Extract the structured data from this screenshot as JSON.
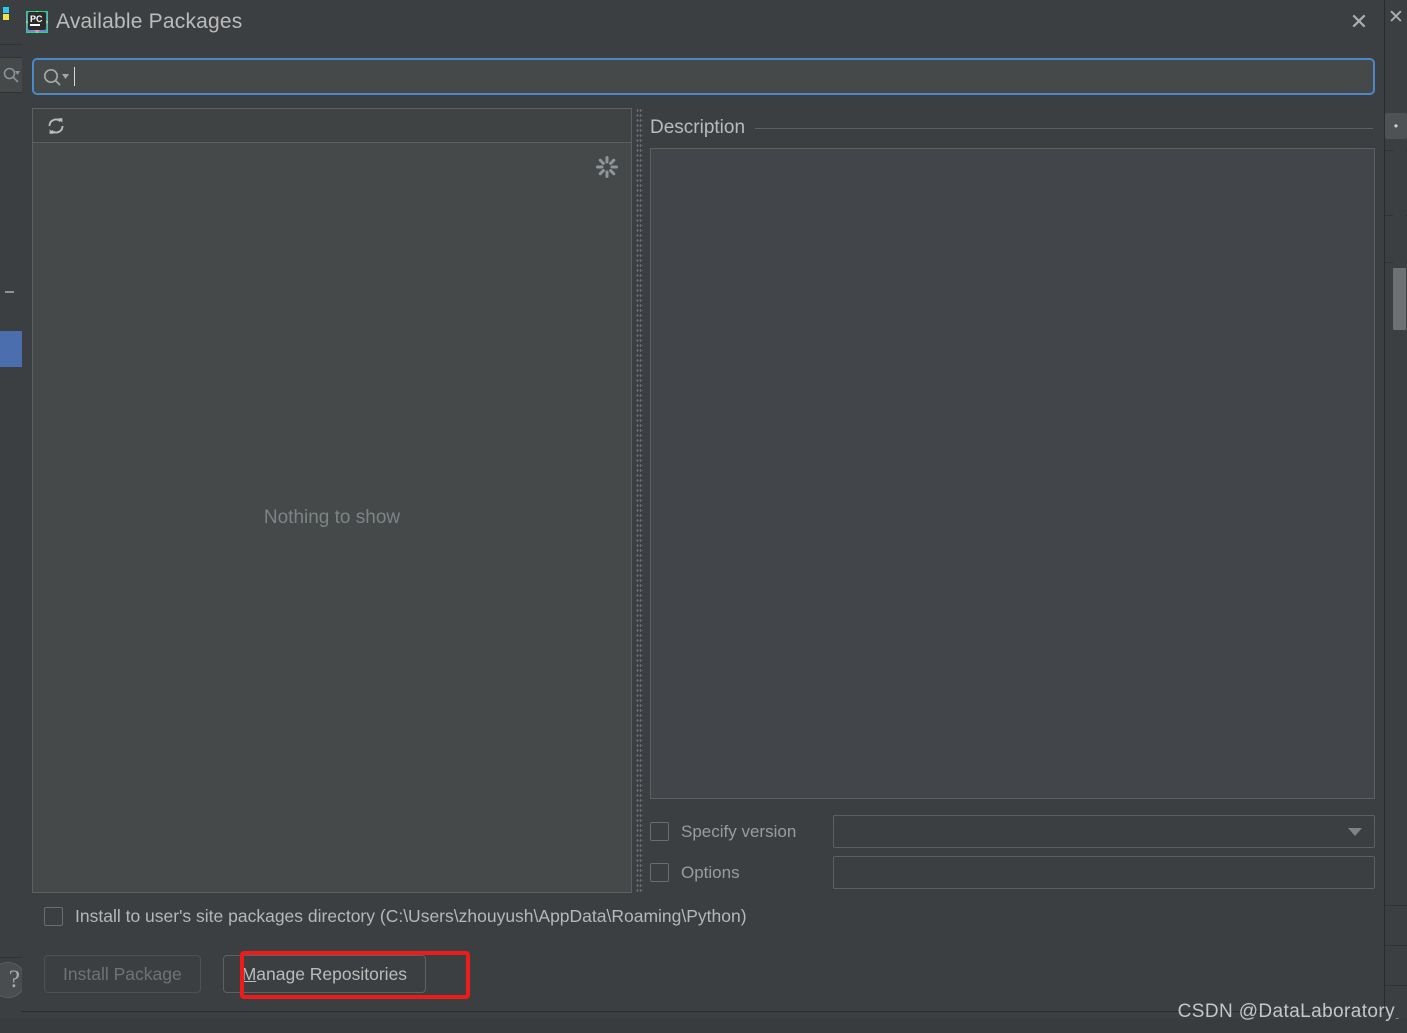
{
  "window": {
    "title": "Available Packages",
    "app_icon": "pycharm-logo-icon",
    "close_label": "✕"
  },
  "search": {
    "icon": "search-icon",
    "value": "",
    "placeholder": ""
  },
  "packages_panel": {
    "refresh_icon": "refresh-icon",
    "loading_icon": "loading-spinner-icon",
    "empty_message": "Nothing to show"
  },
  "description_panel": {
    "label": "Description",
    "body": ""
  },
  "options": [
    {
      "name": "specify-version",
      "label": "Specify version",
      "checked": false,
      "control": "combobox",
      "value": ""
    },
    {
      "name": "options",
      "label": "Options",
      "checked": false,
      "control": "textfield",
      "value": ""
    }
  ],
  "install_scope": {
    "label": "Install to user's site packages directory (C:\\Users\\zhouyush\\AppData\\Roaming\\Python)",
    "checked": false
  },
  "buttons": {
    "install_package": "Install Package",
    "install_package_enabled": false,
    "manage_repositories_prefix": "M",
    "manage_repositories_rest": "anage Repositories"
  },
  "annotation": {
    "highlight_color": "#ee1b1b",
    "target": "manage-repositories-button"
  },
  "watermark": "CSDN @DataLaboratory",
  "background": {
    "help_icon": "question-mark-icon",
    "close_icon": "close-icon",
    "scrollbar": "vertical-scrollbar"
  },
  "colors": {
    "dialog_bg": "#3c3f41",
    "panel_bg": "#45494a",
    "focus_border": "#4a88c7",
    "text": "#bbbbbb",
    "muted_text": "#7e8386",
    "selection_blue": "#4b6eaf"
  }
}
